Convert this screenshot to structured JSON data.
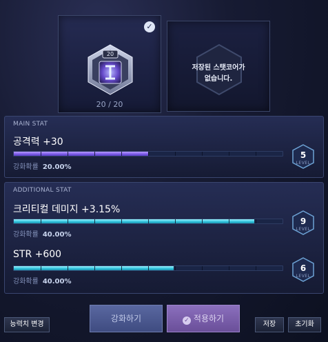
{
  "core": {
    "hex_label": "20",
    "count": "20 / 20",
    "check_icon": "check-circle-icon",
    "empty_text_line1": "저장된 스탯코어가",
    "empty_text_line2": "없습니다."
  },
  "main_stat": {
    "title": "MAIN STAT",
    "stat_text": "공격력 +30",
    "progress": 0.5,
    "prob_label": "강화확률",
    "prob_value": "20.00%",
    "level": "5",
    "level_label": "LEVEL"
  },
  "additional_stat": {
    "title": "ADDITIONAL STAT",
    "items": [
      {
        "stat_text": "크리티컬 데미지 +3.15%",
        "progress": 0.895,
        "prob_label": "강화확률",
        "prob_value": "40.00%",
        "level": "9",
        "level_label": "LEVEL"
      },
      {
        "stat_text": "STR +600",
        "progress": 0.595,
        "prob_label": "강화확률",
        "prob_value": "40.00%",
        "level": "6",
        "level_label": "LEVEL"
      }
    ]
  },
  "buttons": {
    "reset_stat": "능력치 변경",
    "enhance": "강화하기",
    "apply": "적용하기",
    "save": "저장",
    "init": "초기화"
  },
  "colors": {
    "main_bar": "#7a5ae6",
    "add_bar": "#2ec1db",
    "apply_button": "#7d62ad"
  }
}
